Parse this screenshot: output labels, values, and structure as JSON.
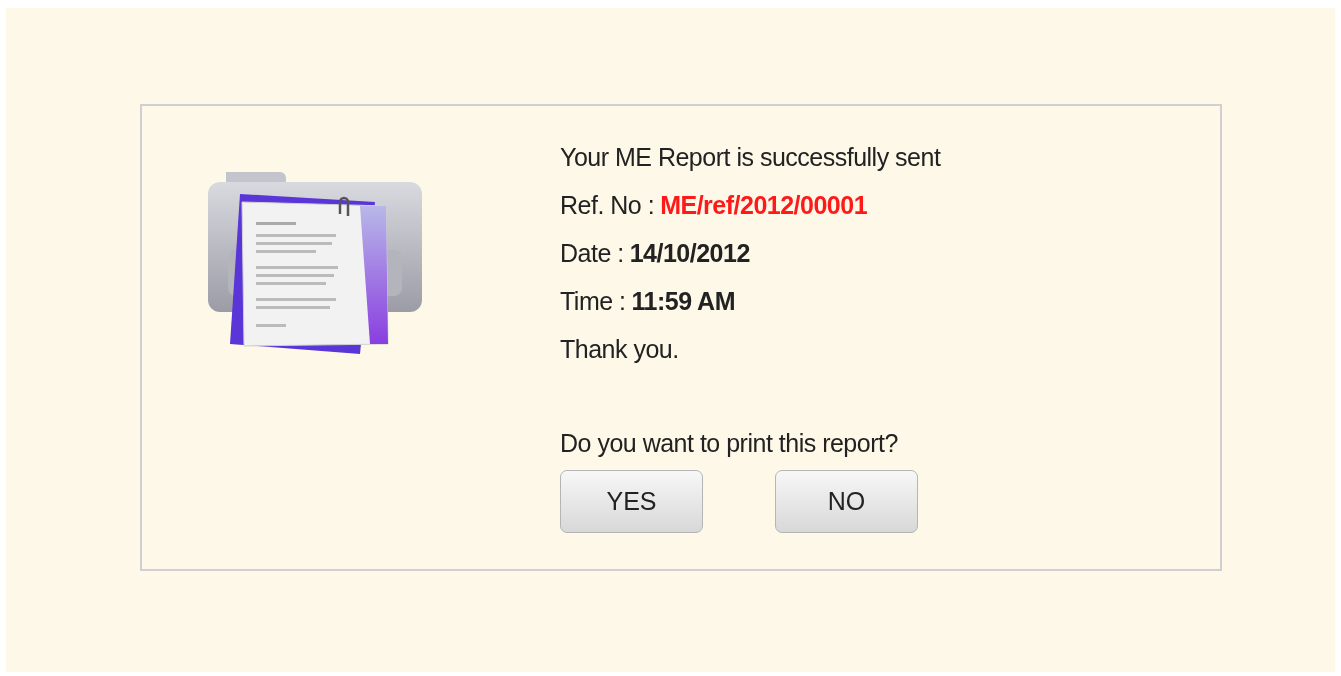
{
  "message": "Your ME Report is successfully sent",
  "details": [
    {
      "label": "Ref. No :",
      "value": "ME/ref/2012/00001",
      "kind": "highlight"
    },
    {
      "label": "Date :",
      "value": "14/10/2012",
      "kind": "plain"
    },
    {
      "label": "Time :",
      "value": "11:59 AM",
      "kind": "plain"
    }
  ],
  "closing": "Thank you.",
  "question": "Do you want to print this report?",
  "buttons": [
    "YES",
    "NO"
  ]
}
